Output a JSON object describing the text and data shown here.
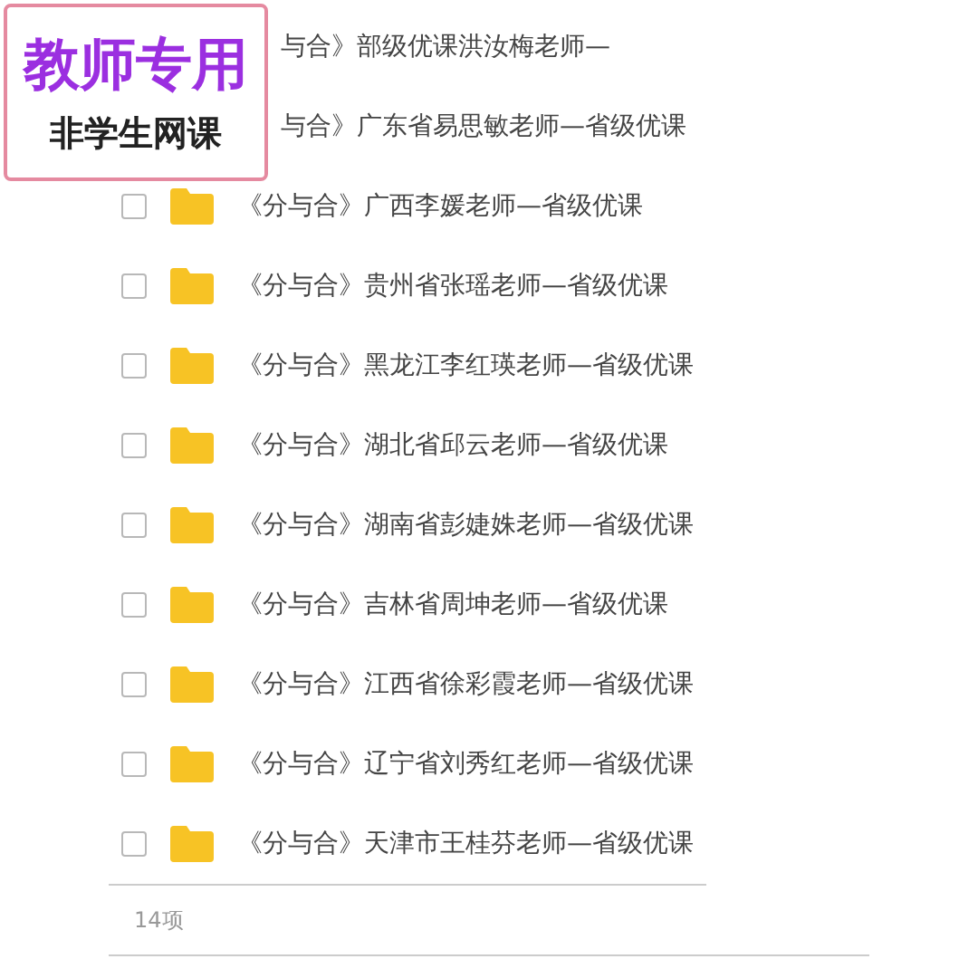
{
  "stamp": {
    "title": "教师专用",
    "subtitle": "非学生网课"
  },
  "files": [
    {
      "kind": "covered",
      "name": "与合》部级优课洪汝梅老师—"
    },
    {
      "kind": "covered",
      "name": "与合》广东省易思敏老师—省级优课"
    },
    {
      "kind": "folder",
      "name": "《分与合》广西李媛老师—省级优课",
      "checked": false
    },
    {
      "kind": "folder",
      "name": "《分与合》贵州省张瑶老师—省级优课",
      "checked": false
    },
    {
      "kind": "folder",
      "name": "《分与合》黑龙江李红瑛老师—省级优课",
      "checked": false
    },
    {
      "kind": "folder",
      "name": "《分与合》湖北省邱云老师—省级优课",
      "checked": false
    },
    {
      "kind": "folder",
      "name": "《分与合》湖南省彭婕姝老师—省级优课",
      "checked": false
    },
    {
      "kind": "folder",
      "name": "《分与合》吉林省周坤老师—省级优课",
      "checked": false
    },
    {
      "kind": "folder",
      "name": "《分与合》江西省徐彩霞老师—省级优课",
      "checked": false
    },
    {
      "kind": "folder",
      "name": "《分与合》辽宁省刘秀红老师—省级优课",
      "checked": false
    },
    {
      "kind": "folder",
      "name": "《分与合》天津市王桂芬老师—省级优课",
      "checked": false
    }
  ],
  "footer": {
    "count": "14项"
  }
}
